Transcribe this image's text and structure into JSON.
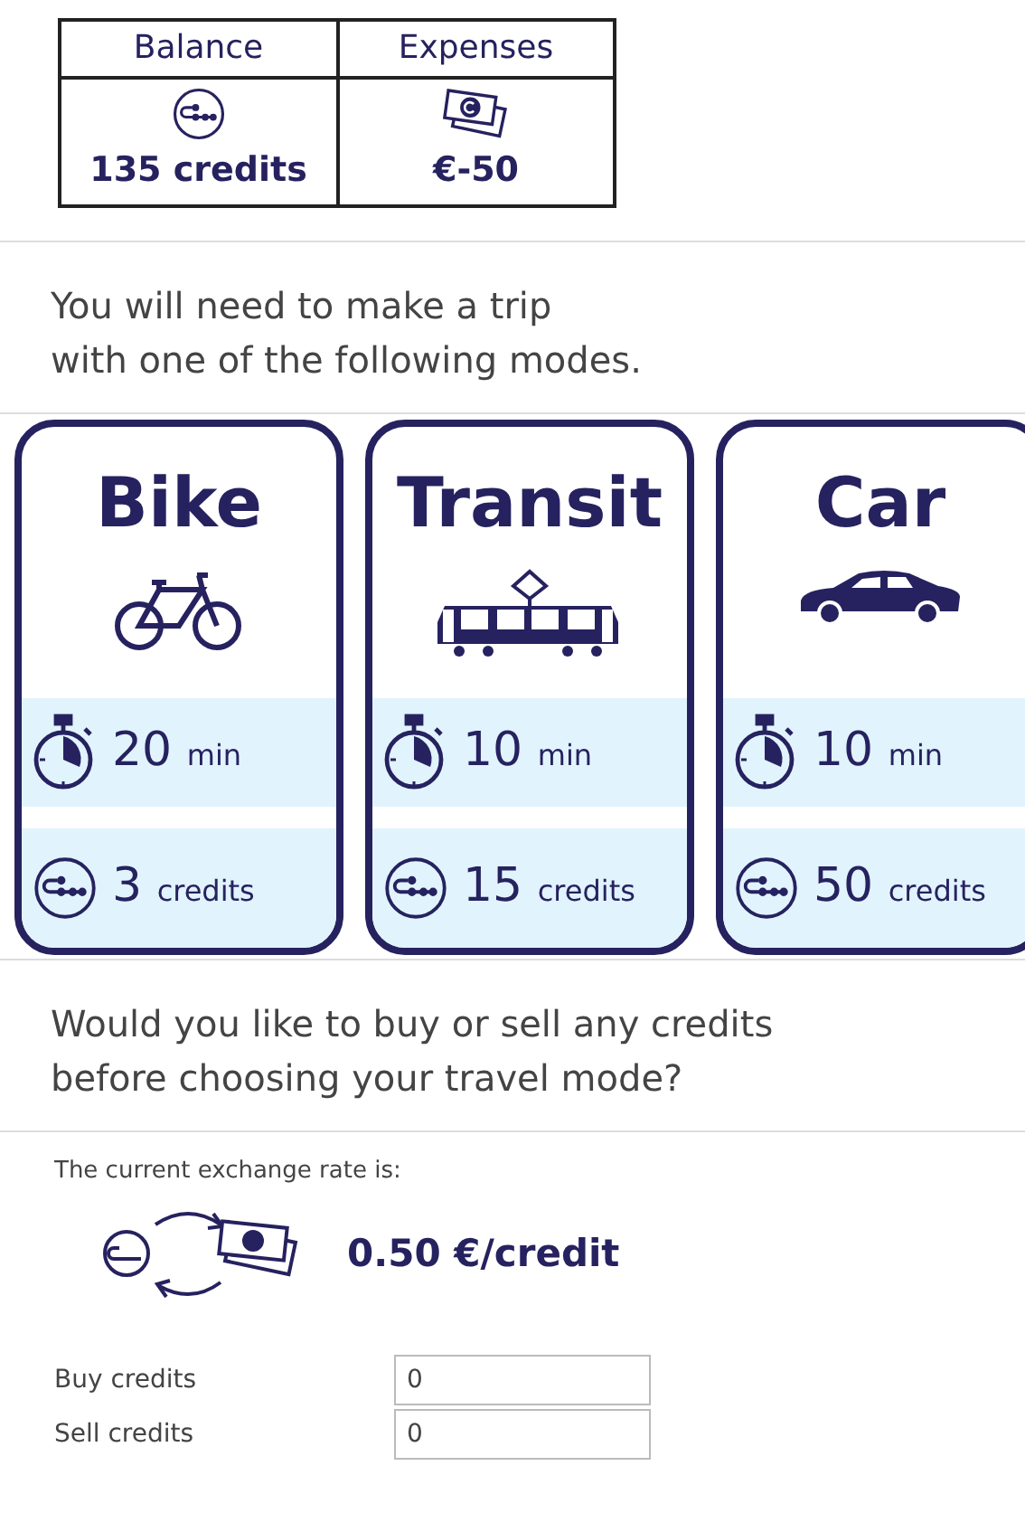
{
  "summary_table": {
    "columns": [
      "Balance",
      "Expenses"
    ],
    "balance": "135 credits",
    "expenses": "€-50"
  },
  "intro": "You will need to make a trip\nwith one of the following modes.",
  "modes": [
    {
      "kind": "bike",
      "name": "Bike",
      "time": "20",
      "time_unit": "min",
      "cost": "3",
      "cost_unit": "credits"
    },
    {
      "kind": "tram",
      "name": "Transit",
      "time": "10",
      "time_unit": "min",
      "cost": "15",
      "cost_unit": "credits"
    },
    {
      "kind": "car",
      "name": "Car",
      "time": "10",
      "time_unit": "min",
      "cost": "50",
      "cost_unit": "credits"
    }
  ],
  "question": "Would you like to buy or sell any credits\nbefore choosing your travel mode?",
  "exchange": {
    "label": "The current exchange rate is:",
    "rate": "0.50 €/credit"
  },
  "fields": [
    {
      "label": "Buy credits",
      "value": "0"
    },
    {
      "label": "Sell credits",
      "value": "0"
    }
  ]
}
